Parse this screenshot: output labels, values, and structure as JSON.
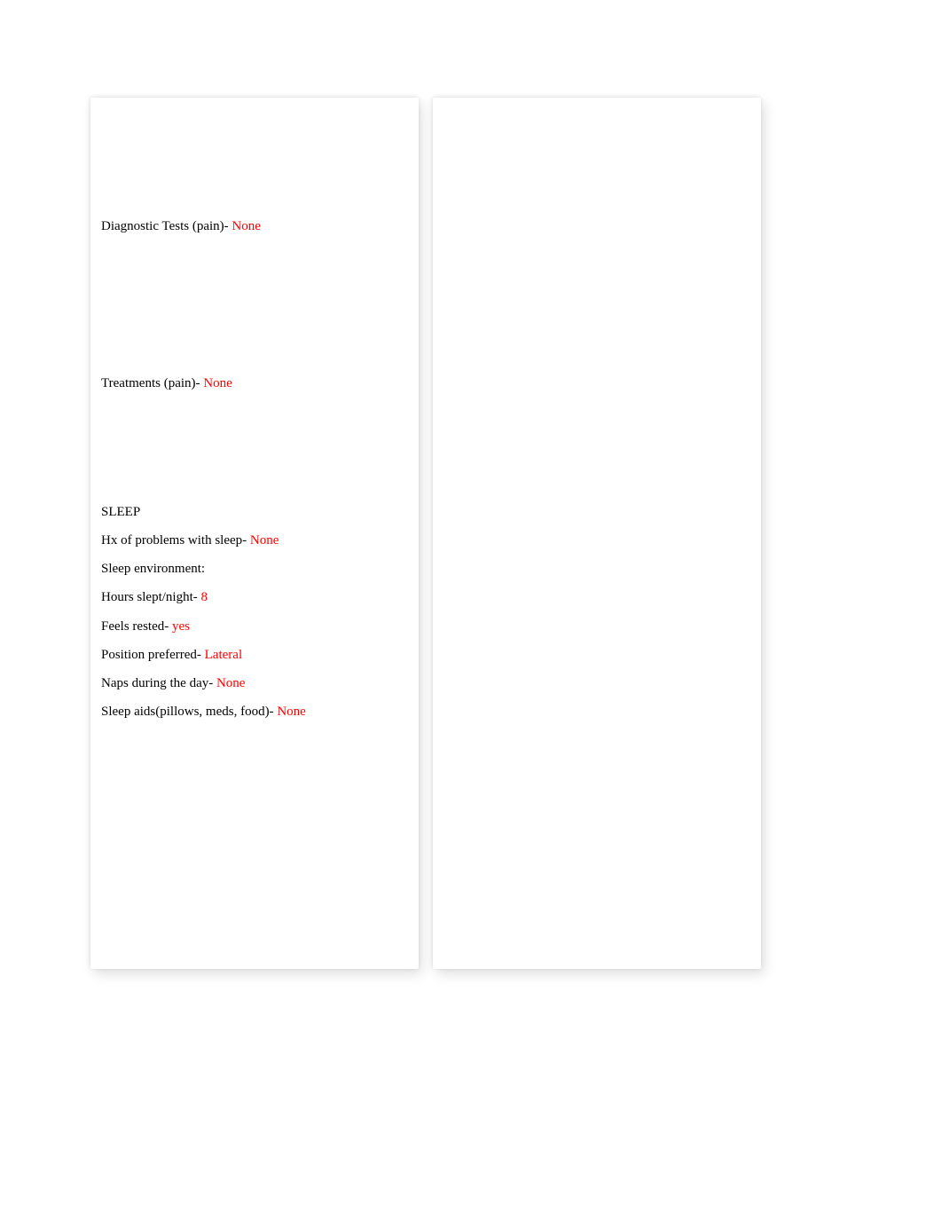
{
  "left": {
    "diag_label": "Diagnostic Tests (pain)- ",
    "diag_value": "None",
    "treat_label": "Treatments (pain)- ",
    "treat_value": "None",
    "sleep_header": "SLEEP",
    "hx_label": "Hx of problems with sleep- ",
    "hx_value": "None",
    "env_label": "Sleep environment:",
    "hours_label": "Hours slept/night- ",
    "hours_value": "8",
    "rested_label": "Feels rested- ",
    "rested_value": "yes",
    "position_label": "Position preferred- ",
    "position_value": "Lateral",
    "naps_label": "Naps during the day- ",
    "naps_value": "None",
    "aids_label": "Sleep aids(pillows, meds, food)- ",
    "aids_value": "None"
  }
}
